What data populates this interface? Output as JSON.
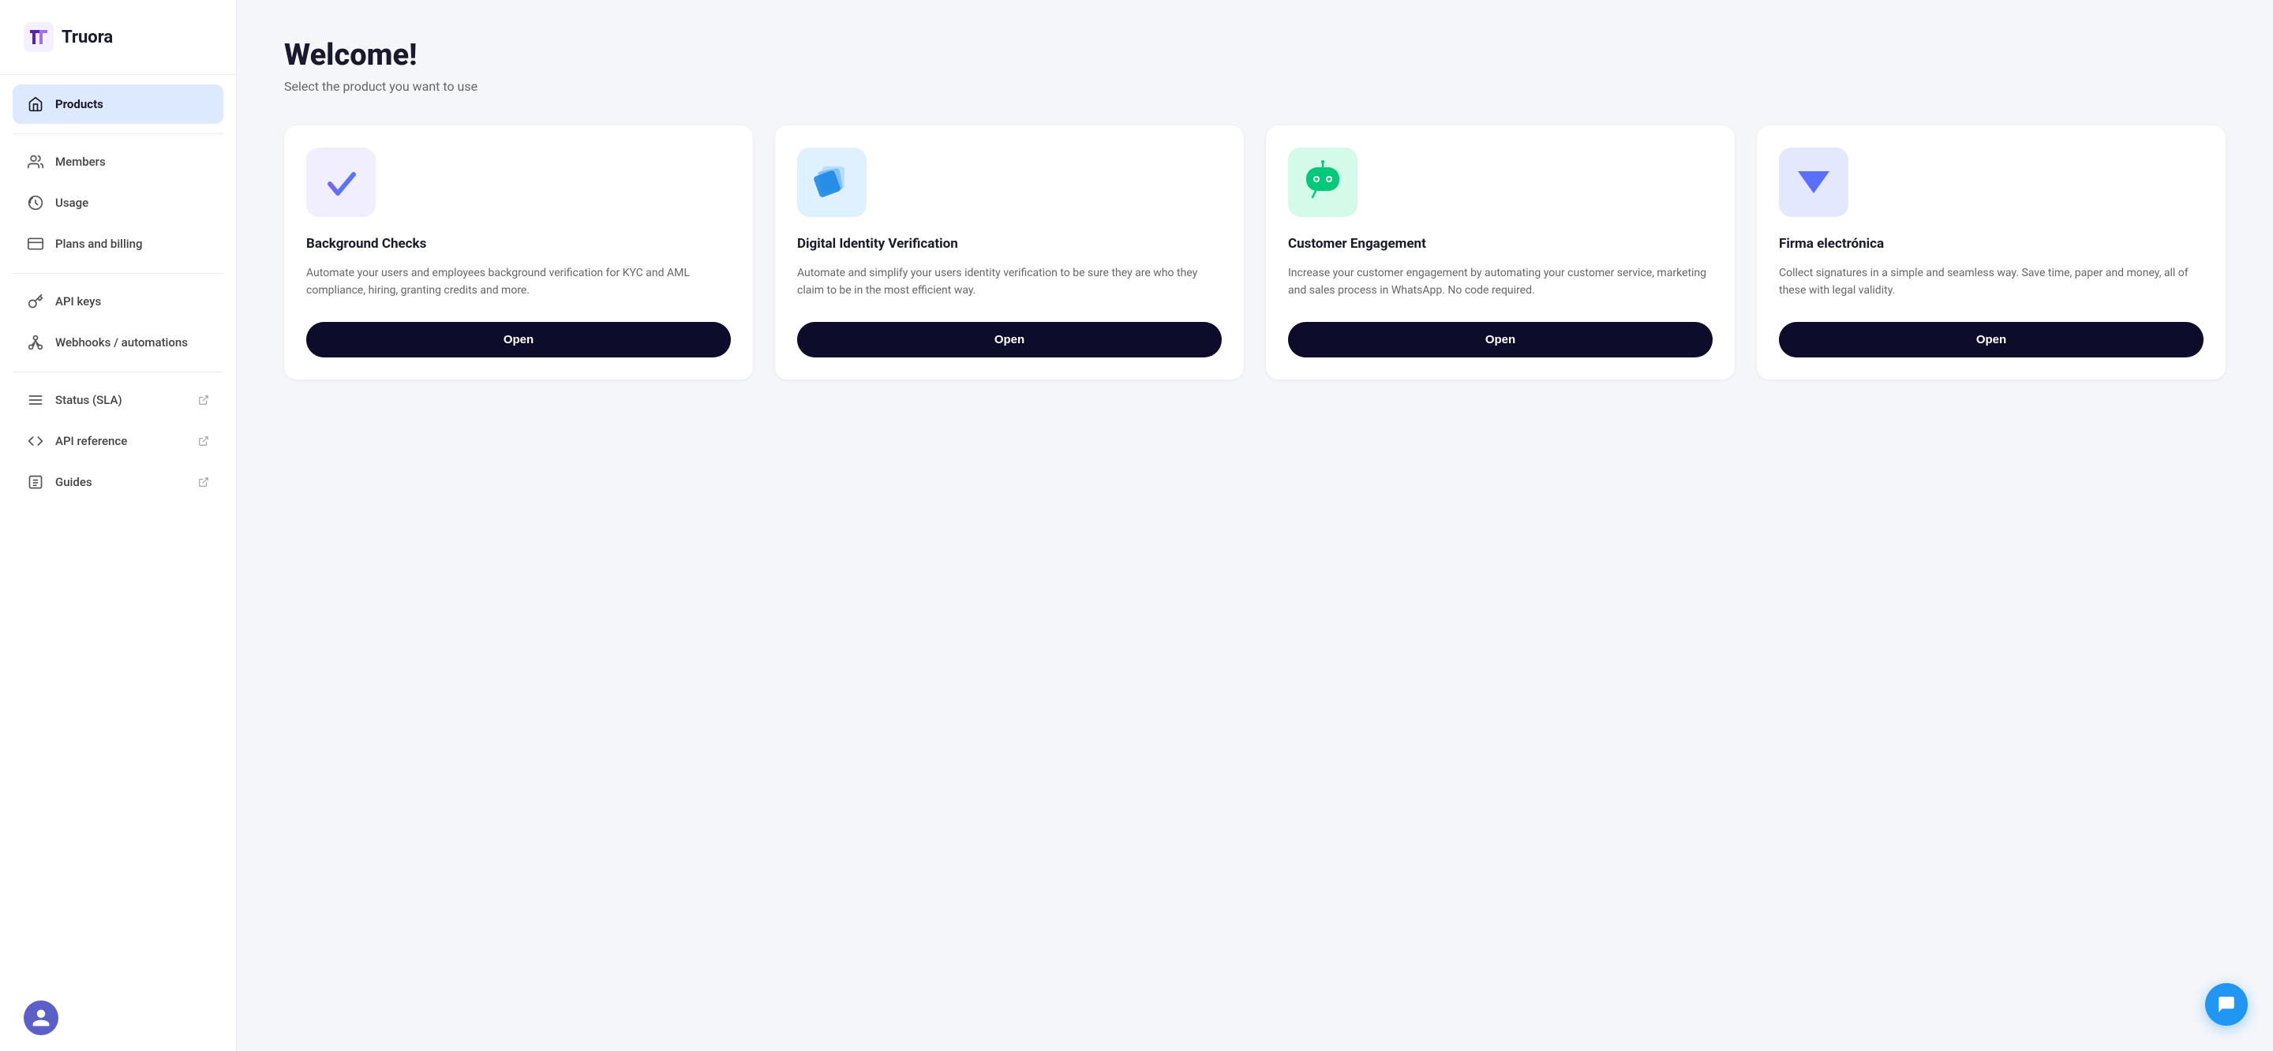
{
  "logo": {
    "text": "Truora"
  },
  "sidebar": {
    "items": [
      {
        "id": "products",
        "label": "Products",
        "icon": "home",
        "active": true,
        "external": false
      },
      {
        "id": "members",
        "label": "Members",
        "icon": "users",
        "active": false,
        "external": false
      },
      {
        "id": "usage",
        "label": "Usage",
        "icon": "gauge",
        "active": false,
        "external": false
      },
      {
        "id": "plans-billing",
        "label": "Plans and billing",
        "icon": "card",
        "active": false,
        "external": false
      },
      {
        "id": "api-keys",
        "label": "API keys",
        "icon": "key",
        "active": false,
        "external": false
      },
      {
        "id": "webhooks",
        "label": "Webhooks / automations",
        "icon": "webhook",
        "active": false,
        "external": false
      },
      {
        "id": "status",
        "label": "Status (SLA)",
        "icon": "status",
        "active": false,
        "external": true
      },
      {
        "id": "api-reference",
        "label": "API reference",
        "icon": "api",
        "active": false,
        "external": true
      },
      {
        "id": "guides",
        "label": "Guides",
        "icon": "guides",
        "active": false,
        "external": true
      }
    ]
  },
  "page": {
    "title": "Welcome!",
    "subtitle": "Select the product you want to use"
  },
  "products": [
    {
      "id": "background-checks",
      "name": "Background Checks",
      "description": "Automate your users and employees background verification for KYC and AML compliance, hiring, granting credits and more.",
      "button_label": "Open",
      "icon_bg": "#f0eeff",
      "icon_color": "#6c3fff"
    },
    {
      "id": "digital-identity",
      "name": "Digital Identity Verification",
      "description": "Automate and simplify your users identity verification to be sure they are who they claim to be in the most efficient way.",
      "button_label": "Open",
      "icon_bg": "#e8f4ff",
      "icon_color": "#4a9eff"
    },
    {
      "id": "customer-engagement",
      "name": "Customer Engagement",
      "description": "Increase your customer engagement by automating your customer service, marketing and sales process in WhatsApp. No code required.",
      "button_label": "Open",
      "icon_bg": "#e0fff4",
      "icon_color": "#00c97a"
    },
    {
      "id": "firma-electronica",
      "name": "Firma electrónica",
      "description": "Collect signatures in a simple and seamless way. Save time, paper and money, all of these with legal validity.",
      "button_label": "Open",
      "icon_bg": "#e8eeff",
      "icon_color": "#5b6fff"
    }
  ]
}
